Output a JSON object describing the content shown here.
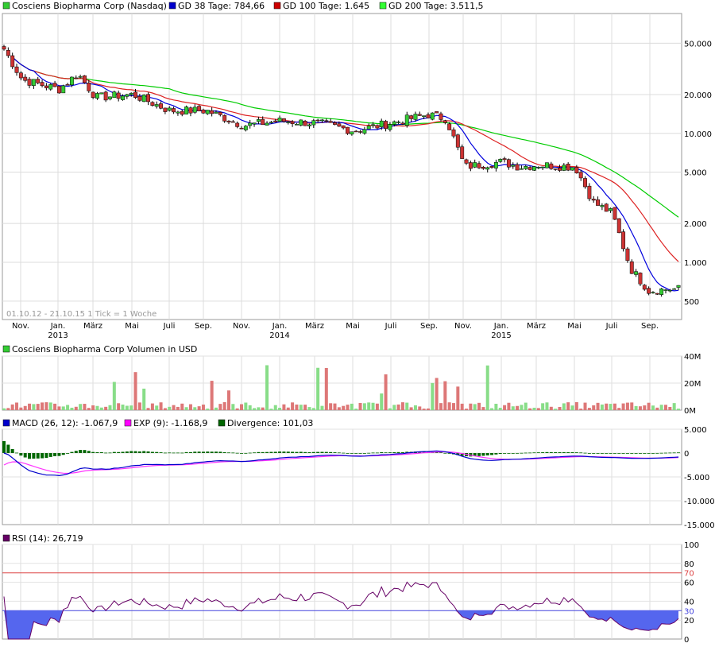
{
  "price_panel": {
    "legend": [
      {
        "label": "Cosciens Biopharma Corp (Nasdaq)",
        "color": "#33cc33"
      },
      {
        "label": "GD 38 Tage: 784,66",
        "color": "#0000cc"
      },
      {
        "label": "GD 100 Tage: 1.645",
        "color": "#cc0000"
      },
      {
        "label": "GD 200 Tage: 3.511,5",
        "color": "#00cc00"
      }
    ],
    "range_note": "01.10.12 - 21.10.15   1 Tick = 1 Woche",
    "x_labels": [
      {
        "month": "Nov.",
        "year": ""
      },
      {
        "month": "Jan.",
        "year": "2013"
      },
      {
        "month": "März",
        "year": ""
      },
      {
        "month": "Mai",
        "year": ""
      },
      {
        "month": "Juli",
        "year": ""
      },
      {
        "month": "Sep.",
        "year": ""
      },
      {
        "month": "Nov.",
        "year": ""
      },
      {
        "month": "Jan.",
        "year": "2014"
      },
      {
        "month": "März",
        "year": ""
      },
      {
        "month": "Mai",
        "year": ""
      },
      {
        "month": "Juli",
        "year": ""
      },
      {
        "month": "Sep.",
        "year": ""
      },
      {
        "month": "Nov.",
        "year": ""
      },
      {
        "month": "Jan.",
        "year": "2015"
      },
      {
        "month": "März",
        "year": ""
      },
      {
        "month": "Mai",
        "year": ""
      },
      {
        "month": "Juli",
        "year": ""
      },
      {
        "month": "Sep.",
        "year": ""
      }
    ],
    "y_labels": [
      "50.000",
      "20.000",
      "10.000",
      "5.000",
      "2.000",
      "1.000",
      "500"
    ]
  },
  "volume_panel": {
    "legend": [
      {
        "label": "Cosciens Biopharma Corp Volumen in USD",
        "color": "#33cc33"
      }
    ],
    "y_labels": [
      "40M",
      "20M",
      "0M"
    ]
  },
  "macd_panel": {
    "legend": [
      {
        "label": "MACD (26, 12): -1.067,9",
        "color": "#0000cc"
      },
      {
        "label": "EXP (9): -1.168,9",
        "color": "#ff00ff"
      },
      {
        "label": "Divergence: 101,03",
        "color": "#006600"
      }
    ],
    "y_labels": [
      "5.000",
      "0",
      "-5.000",
      "-10.000",
      "-15.000"
    ]
  },
  "rsi_panel": {
    "legend": [
      {
        "label": "RSI (14): 26,719",
        "color": "#660066"
      }
    ],
    "y_labels": [
      "100",
      "80",
      "70",
      "60",
      "40",
      "30",
      "20",
      "0"
    ]
  },
  "chart_data": [
    {
      "type": "candlestick",
      "title": "Cosciens Biopharma Corp (Nasdaq)",
      "scale": "log",
      "ylim": [
        350,
        90000
      ],
      "period": "01.10.12 - 21.10.15",
      "tick": "1 Woche",
      "close_approx": [
        {
          "date": "2012-10",
          "value": 45000
        },
        {
          "date": "2012-11",
          "value": 26000
        },
        {
          "date": "2013-01",
          "value": 22000
        },
        {
          "date": "2013-02",
          "value": 29000
        },
        {
          "date": "2013-03",
          "value": 19000
        },
        {
          "date": "2013-05",
          "value": 20000
        },
        {
          "date": "2013-07",
          "value": 15000
        },
        {
          "date": "2013-09",
          "value": 15000
        },
        {
          "date": "2013-11",
          "value": 11500
        },
        {
          "date": "2014-01",
          "value": 12500
        },
        {
          "date": "2014-03",
          "value": 12000
        },
        {
          "date": "2014-05",
          "value": 10500
        },
        {
          "date": "2014-07",
          "value": 12000
        },
        {
          "date": "2014-09",
          "value": 14000
        },
        {
          "date": "2014-10",
          "value": 13000
        },
        {
          "date": "2014-11",
          "value": 5500
        },
        {
          "date": "2015-01",
          "value": 6000
        },
        {
          "date": "2015-02",
          "value": 5500
        },
        {
          "date": "2015-03",
          "value": 5700
        },
        {
          "date": "2015-05",
          "value": 5500
        },
        {
          "date": "2015-06",
          "value": 2900
        },
        {
          "date": "2015-07",
          "value": 2400
        },
        {
          "date": "2015-08",
          "value": 900
        },
        {
          "date": "2015-09",
          "value": 600
        },
        {
          "date": "2015-10",
          "value": 620
        }
      ],
      "series": [
        {
          "name": "GD 38 Tage",
          "last": "784,66"
        },
        {
          "name": "GD 100 Tage",
          "last": "1.645"
        },
        {
          "name": "GD 200 Tage",
          "last": "3.511,5"
        }
      ]
    },
    {
      "type": "bar",
      "title": "Cosciens Biopharma Corp Volumen in USD",
      "ylim": [
        0,
        40
      ],
      "ylabel_unit": "M"
    },
    {
      "type": "line",
      "title": "MACD (26, 12)",
      "ylim": [
        -15000,
        5000
      ],
      "series": [
        {
          "name": "MACD (26, 12)",
          "last": "-1.067,9"
        },
        {
          "name": "EXP (9)",
          "last": "-1.168,9"
        },
        {
          "name": "Divergence",
          "last": "101,03"
        }
      ]
    },
    {
      "type": "line",
      "title": "RSI (14)",
      "ylim": [
        0,
        100
      ],
      "last": "26,719",
      "reference_lines": [
        70,
        30
      ]
    }
  ]
}
